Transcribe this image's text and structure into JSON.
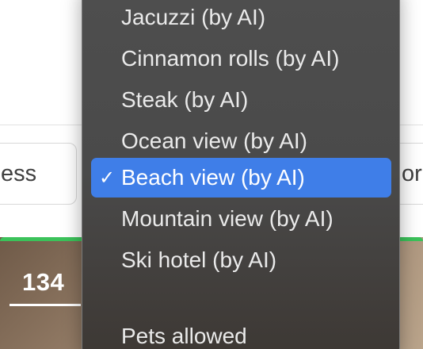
{
  "background": {
    "search_field_value": "ess",
    "right_filter_text": "or",
    "card_count": "134"
  },
  "menu": {
    "items": [
      {
        "label": "Jacuzzi (by AI)",
        "selected": false
      },
      {
        "label": "Cinnamon rolls (by AI)",
        "selected": false
      },
      {
        "label": "Steak (by AI)",
        "selected": false
      },
      {
        "label": "Ocean view (by AI)",
        "selected": false
      },
      {
        "label": "Beach view (by AI)",
        "selected": true
      },
      {
        "label": "Mountain view (by AI)",
        "selected": false
      },
      {
        "label": "Ski hotel (by AI)",
        "selected": false
      },
      {
        "label": "Pets allowed",
        "selected": false
      }
    ],
    "check_glyph": "✓"
  },
  "colors": {
    "menu_background": "#4a4a4a",
    "selection_highlight": "#3f7ee8",
    "card_accent": "#3bc25a"
  }
}
